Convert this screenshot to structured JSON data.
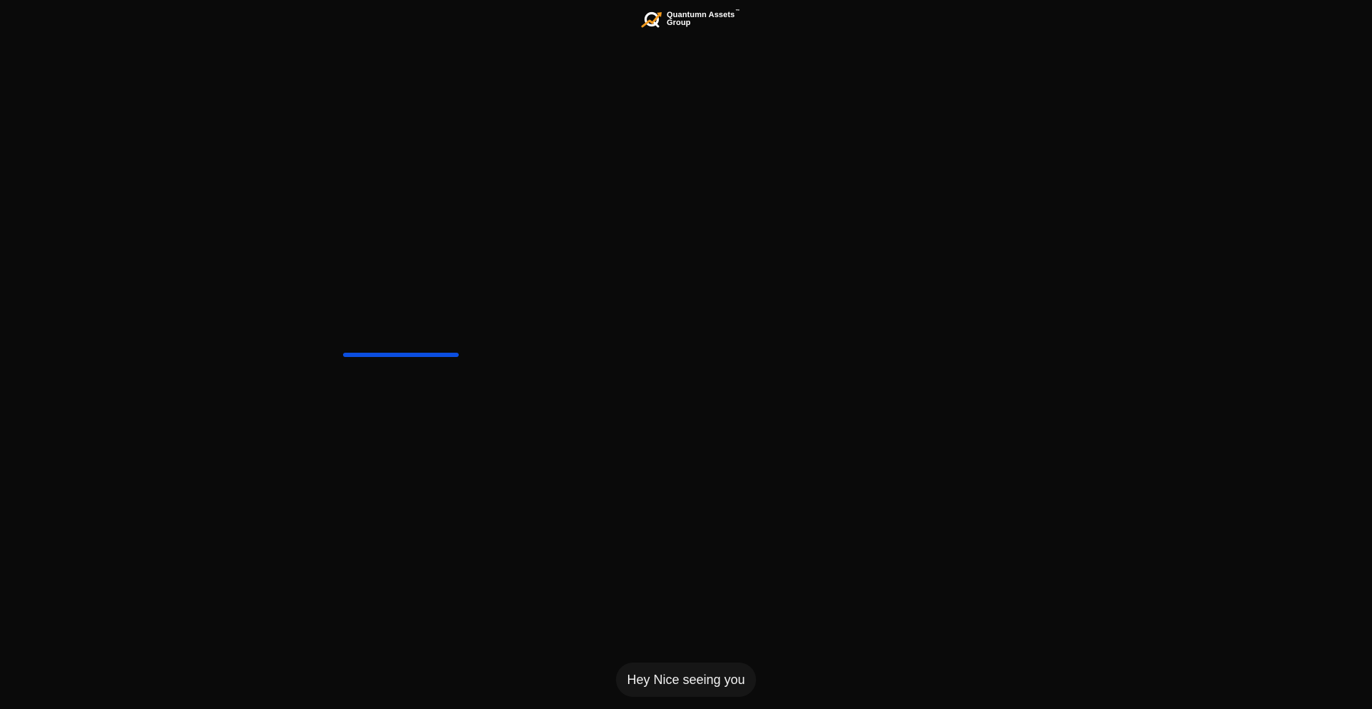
{
  "header": {
    "brand_line1": "Quantumn Assets",
    "brand_tm": "™",
    "brand_line2": "Group",
    "logo_icon": "quantumn-assets-logo-icon"
  },
  "loader": {
    "progress": 0.85,
    "color": "#0b4ee0"
  },
  "chat": {
    "greeting": "Hey Nice seeing you"
  },
  "colors": {
    "background": "#0a0a0a",
    "bubble": "#161616",
    "accent_orange": "#f39a1e"
  }
}
